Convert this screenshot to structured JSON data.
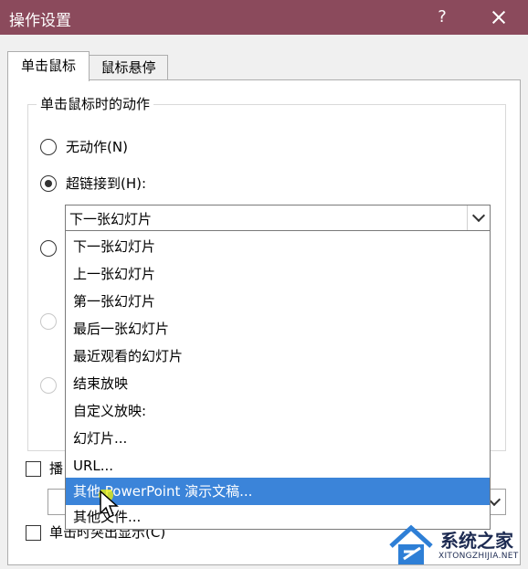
{
  "window": {
    "title": "操作设置",
    "help": "?"
  },
  "tabs": [
    {
      "label": "单击鼠标",
      "active": true
    },
    {
      "label": "鼠标悬停",
      "active": false
    }
  ],
  "group": {
    "legend": "单击鼠标时的动作"
  },
  "options": {
    "no_action": "无动作(N)",
    "hyperlink": "超链接到(H):"
  },
  "hyperlink_select": {
    "value": "下一张幻灯片"
  },
  "dropdown_items": [
    "下一张幻灯片",
    "上一张幻灯片",
    "第一张幻灯片",
    "最后一张幻灯片",
    "最近观看的幻灯片",
    "结束放映",
    "自定义放映:",
    "幻灯片...",
    "URL...",
    "其他 PowerPoint 演示文稿...",
    "其他文件..."
  ],
  "selected_index": 9,
  "checkboxes": {
    "play_sound_partial": "播",
    "highlight_click": "单击时突出显示(C)"
  },
  "watermark": {
    "name": "系统之家",
    "url": "XITONGZHIJIA.NET"
  },
  "colors": {
    "titlebar": "#8b4a5c",
    "selection": "#3b84d9"
  }
}
